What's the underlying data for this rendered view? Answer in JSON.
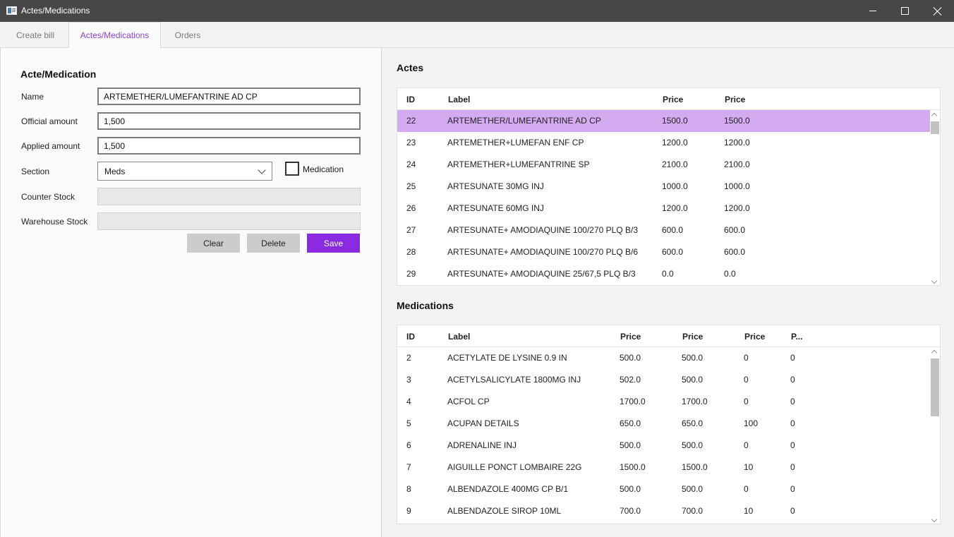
{
  "window": {
    "title": "Actes/Medications"
  },
  "tabs": [
    {
      "label": "Create bill"
    },
    {
      "label": "Actes/Medications"
    },
    {
      "label": "Orders"
    }
  ],
  "form": {
    "title": "Acte/Medication",
    "name_label": "Name",
    "name_value": "ARTEMETHER/LUMEFANTRINE AD CP",
    "official_label": "Official amount",
    "official_value": "1,500",
    "applied_label": "Applied amount",
    "applied_value": "1,500",
    "section_label": "Section",
    "section_value": "Meds",
    "medication_label": "Medication",
    "medication_checked": false,
    "counter_label": "Counter Stock",
    "counter_value": "",
    "warehouse_label": "Warehouse Stock",
    "warehouse_value": "",
    "clear_label": "Clear",
    "delete_label": "Delete",
    "save_label": "Save"
  },
  "actes": {
    "title": "Actes",
    "columns": [
      "ID",
      "Label",
      "Price",
      "Price"
    ],
    "rows": [
      [
        "22",
        "ARTEMETHER/LUMEFANTRINE AD CP",
        "1500.0",
        "1500.0"
      ],
      [
        "23",
        "ARTEMETHER+LUMEFAN ENF CP",
        "1200.0",
        "1200.0"
      ],
      [
        "24",
        "ARTEMETHER+LUMEFANTRINE SP",
        "2100.0",
        "2100.0"
      ],
      [
        "25",
        "ARTESUNATE 30MG INJ",
        "1000.0",
        "1000.0"
      ],
      [
        "26",
        "ARTESUNATE 60MG INJ",
        "1200.0",
        "1200.0"
      ],
      [
        "27",
        "ARTESUNATE+ AMODIAQUINE 100/270 PLQ B/3",
        "600.0",
        "600.0"
      ],
      [
        "28",
        "ARTESUNATE+ AMODIAQUINE 100/270 PLQ B/6",
        "600.0",
        "600.0"
      ],
      [
        "29",
        "ARTESUNATE+ AMODIAQUINE 25/67,5 PLQ B/3",
        "0.0",
        "0.0"
      ]
    ],
    "selected_row": 0
  },
  "medications": {
    "title": "Medications",
    "columns": [
      "ID",
      "Label",
      "Price",
      "Price",
      "Price",
      "P..."
    ],
    "rows": [
      [
        "2",
        "ACETYLATE DE LYSINE 0.9 IN",
        "500.0",
        "500.0",
        "0",
        "0"
      ],
      [
        "3",
        "ACETYLSALICYLATE 1800MG INJ",
        "502.0",
        "500.0",
        "0",
        "0"
      ],
      [
        "4",
        "ACFOL CP",
        "1700.0",
        "1700.0",
        "0",
        "0"
      ],
      [
        "5",
        "ACUPAN DETAILS",
        "650.0",
        "650.0",
        "100",
        "0"
      ],
      [
        "6",
        "ADRENALINE INJ",
        "500.0",
        "500.0",
        "0",
        "0"
      ],
      [
        "7",
        "AIGUILLE PONCT LOMBAIRE 22G",
        "1500.0",
        "1500.0",
        "10",
        "0"
      ],
      [
        "8",
        "ALBENDAZOLE 400MG CP B/1",
        "500.0",
        "500.0",
        "0",
        "0"
      ],
      [
        "9",
        "ALBENDAZOLE SIROP 10ML",
        "700.0",
        "700.0",
        "10",
        "0"
      ]
    ]
  },
  "icons": {
    "app": "app-window-icon",
    "minimize": "minimize-icon",
    "maximize": "maximize-icon",
    "close": "close-icon"
  },
  "colors": {
    "accent": "#8a2be2",
    "selected_row": "#d4aaf0",
    "titlebar": "#474747"
  }
}
